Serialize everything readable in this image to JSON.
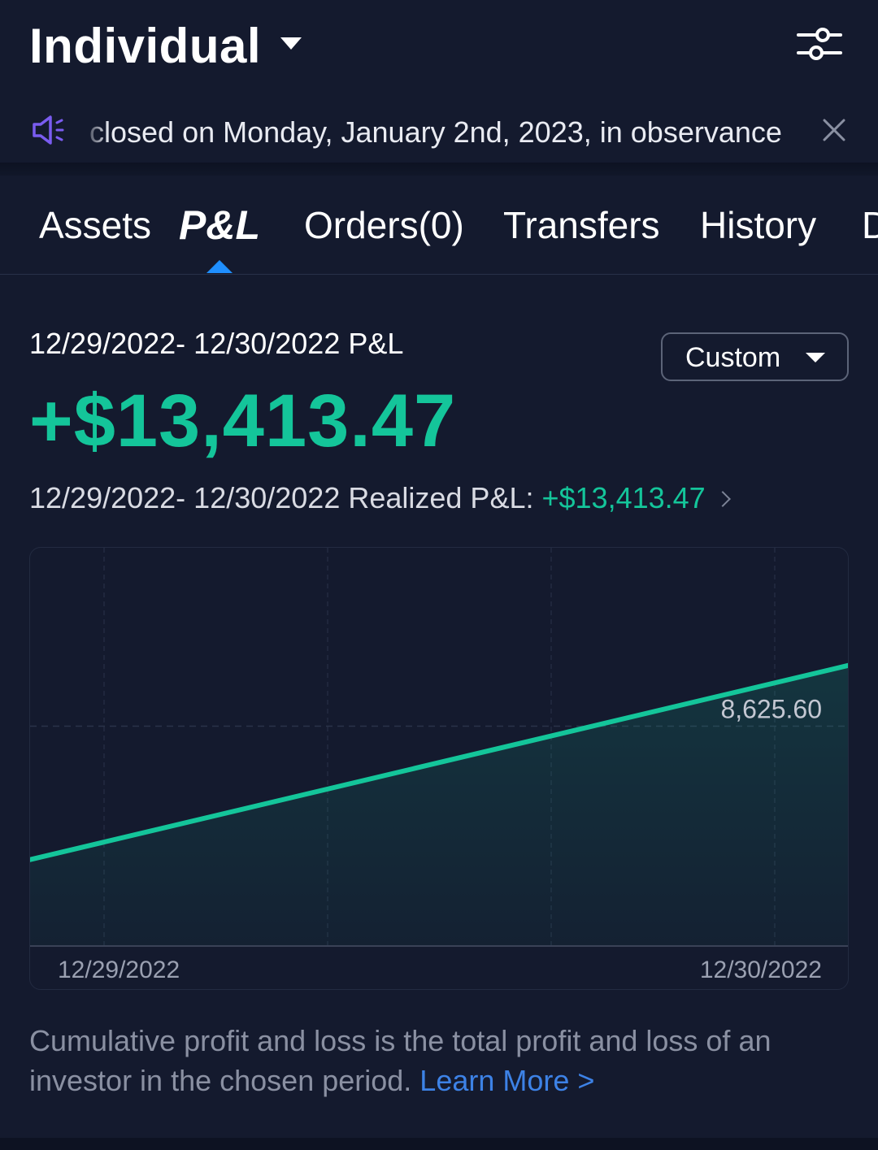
{
  "header": {
    "account_title": "Individual",
    "filter_icon": "sliders-icon"
  },
  "notice": {
    "icon": "speaker-announcement-icon",
    "text": "closed on Monday, January 2nd, 2023, in observance",
    "close_icon": "close-icon"
  },
  "tabs": [
    {
      "label": "Assets",
      "active": false
    },
    {
      "label": "P&L",
      "active": true
    },
    {
      "label": "Orders(0)",
      "active": false
    },
    {
      "label": "Transfers",
      "active": false
    },
    {
      "label": "History",
      "active": false
    },
    {
      "label": "D",
      "active": false
    }
  ],
  "pnl": {
    "range_label": "12/29/2022- 12/30/2022 P&L",
    "period_select": "Custom",
    "amount": "+$13,413.47",
    "realized_label": "12/29/2022- 12/30/2022 Realized P&L: ",
    "realized_value": "+$13,413.47"
  },
  "chart_data": {
    "type": "area",
    "x": [
      "12/29/2022",
      "12/30/2022"
    ],
    "values": [
      1690,
      11800
    ],
    "reference_label": "8,625.60",
    "reference_value": 8625.6,
    "ylim": [
      -2800,
      17900
    ],
    "grid": true,
    "colors": {
      "line": "#14c59a",
      "fill": "#14c59a"
    }
  },
  "footer": {
    "description": "Cumulative profit and loss is the total profit and loss of an investor in the chosen period. ",
    "learn_more": "Learn More >"
  },
  "colors": {
    "background": "#141a2e",
    "accent_green": "#14c59a",
    "accent_blue": "#1f8fff",
    "link_blue": "#3d82e6"
  }
}
